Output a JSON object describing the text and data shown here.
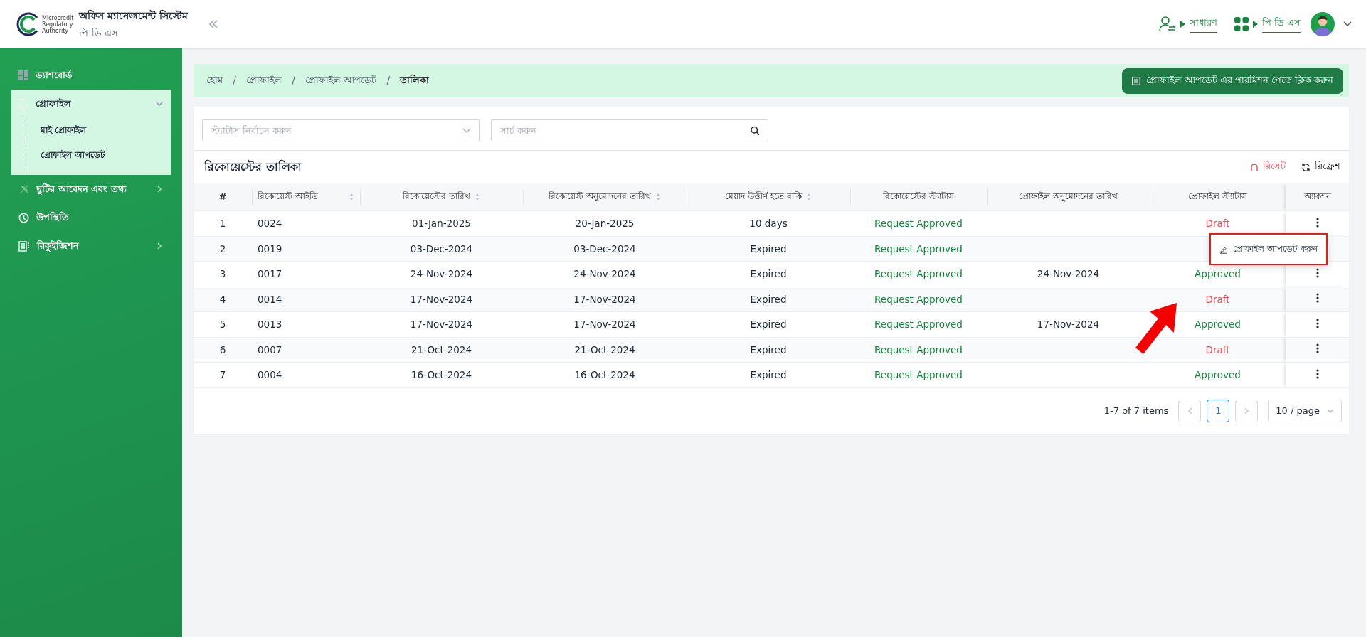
{
  "header": {
    "logo_text": [
      "Microcredit",
      "Regulatory",
      "Authority"
    ],
    "app_title": "অফিস ম্যানেজমেন্ট সিস্টেম",
    "app_subtitle": "পি ডি এস",
    "role_link": "সাধারণ",
    "office_link": "পি ডি এস"
  },
  "sidebar": {
    "items": [
      {
        "label": "ড্যাশবোর্ড"
      },
      {
        "label": "প্রোফাইল",
        "expanded": true,
        "children": [
          {
            "label": "মাই প্রোফাইল"
          },
          {
            "label": "প্রোফাইল আপডেট"
          }
        ]
      },
      {
        "label": "ছুটির আবেদন এবং তথ্য",
        "expanded": false
      },
      {
        "label": "উপস্থিতি"
      },
      {
        "label": "রিকুইজিশন",
        "expanded": false
      }
    ]
  },
  "breadcrumb_separator": "/",
  "breadcrumb": [
    {
      "label": "হোম",
      "current": false
    },
    {
      "label": "প্রোফাইল",
      "current": false
    },
    {
      "label": "প্রোফাইল আপডেট",
      "current": false
    },
    {
      "label": "তালিকা",
      "current": true
    }
  ],
  "permission_button": "প্রোফাইল আপডেট এর পারমিশন পেতে ক্লিক করুন",
  "filters": {
    "status_placeholder": "স্ট্যাটাস নির্বাচন করুন",
    "search_placeholder": "সার্চ করুন"
  },
  "list_title": "রিকোয়েস্টের তালিকা",
  "reset_button": "রিসেট",
  "refresh_button": "রিফ্রেশ",
  "table": {
    "columns": [
      {
        "label": "#",
        "sortable": false
      },
      {
        "label": "রিকোয়েস্ট আইডি",
        "sortable": true
      },
      {
        "label": "রিকোয়েস্টের তারিখ",
        "sortable": true
      },
      {
        "label": "রিকোয়েস্ট অনুমোদনের তারিখ",
        "sortable": true
      },
      {
        "label": "মেয়াদ উত্তীর্ণ হতে বাকি",
        "sortable": true
      },
      {
        "label": "রিকোয়েস্টের স্ট্যাটাস",
        "sortable": false
      },
      {
        "label": "প্রোফাইল অনুমোদনের তারিখ",
        "sortable": false
      },
      {
        "label": "প্রোফাইল স্ট্যাটাস",
        "sortable": false
      },
      {
        "label": "অ্যাকশন",
        "sortable": false
      }
    ],
    "rows": [
      {
        "number": "1",
        "request_id": "0024",
        "request_date": "01-Jan-2025",
        "approval_date": "20-Jan-2025",
        "remaining": "10 days",
        "request_status": "Request Approved",
        "profile_status": "Draft",
        "color": "#e5484d"
      },
      {
        "number": "2",
        "request_id": "0019",
        "request_date": "03-Dec-2024",
        "approval_date": "03-Dec-2024",
        "remaining": "Expired",
        "request_status": "Request Approved"
      },
      {
        "number": "3",
        "request_id": "0017",
        "request_date": "24-Nov-2024",
        "approval_date": "24-Nov-2024",
        "remaining": "Expired",
        "request_status": "Request Approved",
        "profile_approval_date": "24-Nov-2024",
        "profile_status": "Approved",
        "color": "#15843c"
      },
      {
        "number": "4",
        "request_id": "0014",
        "request_date": "17-Nov-2024",
        "approval_date": "17-Nov-2024",
        "remaining": "Expired",
        "request_status": "Request Approved",
        "profile_status": "Draft",
        "color": "#e5484d"
      },
      {
        "number": "5",
        "request_id": "0013",
        "request_date": "17-Nov-2024",
        "approval_date": "17-Nov-2024",
        "remaining": "Expired",
        "request_status": "Request Approved",
        "profile_approval_date": "17-Nov-2024",
        "profile_status": "Approved",
        "color": "#15843c"
      },
      {
        "number": "6",
        "request_id": "0007",
        "request_date": "21-Oct-2024",
        "approval_date": "21-Oct-2024",
        "remaining": "Expired",
        "request_status": "Request Approved",
        "profile_status": "Draft",
        "color": "#e5484d"
      },
      {
        "number": "7",
        "request_id": "0004",
        "request_date": "16-Oct-2024",
        "approval_date": "16-Oct-2024",
        "remaining": "Expired",
        "request_status": "Request Approved",
        "profile_status": "Approved",
        "color": "#15843c"
      }
    ]
  },
  "action_menu": {
    "label": "প্রোফাইল আপডেট করুন",
    "highlighted": true
  },
  "pagination": {
    "summary": "1-7 of 7 items",
    "pages": [
      {
        "label": "1",
        "selected": true
      }
    ],
    "page_size": "10 / page"
  }
}
